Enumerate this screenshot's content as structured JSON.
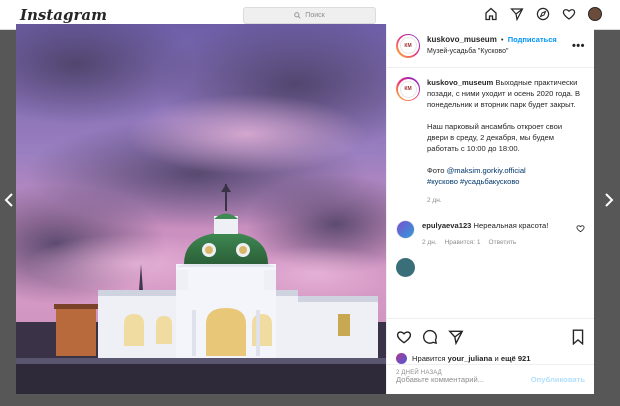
{
  "app": {
    "logo": "Instagram",
    "search_placeholder": "Поиск"
  },
  "post": {
    "username": "kuskovo_museum",
    "follow_label": "Подписаться",
    "dot": "•",
    "location": "Музей-усадьба \"Кусково\"",
    "more": "•••",
    "caption_p1": "Выходные практически позади, с ними уходит и осень 2020 года. В понедельник и вторник парк будет закрыт.",
    "caption_p2": "Наш парковый ансамбль откроет свои двери в среду, 2 декабря, мы будем работать с 10:00 до 18:00.",
    "photo_prefix": "Фото",
    "photo_credit": "@maksim.gorkiy.official",
    "hashtags": "#кусково #усадьбакусково",
    "caption_time": "2 дн.",
    "likes_prefix": "Нравится",
    "likes_user": "your_juliana",
    "likes_and": "и",
    "likes_rest": "ещё 921",
    "posted_ago": "2 ДНЕЙ НАЗАД",
    "comment_placeholder": "Добавьте комментарий...",
    "post_button": "Опубликовать"
  },
  "comments": [
    {
      "username": "epulyaeva123",
      "text": "Нереальная красота!",
      "time": "2 дн.",
      "likes": "Нравится: 1",
      "reply": "Ответить"
    }
  ],
  "colors": {
    "follow": "#0095f6",
    "link": "#00376b",
    "muted": "#8e8e8e",
    "post_disabled": "#b2dffc"
  }
}
